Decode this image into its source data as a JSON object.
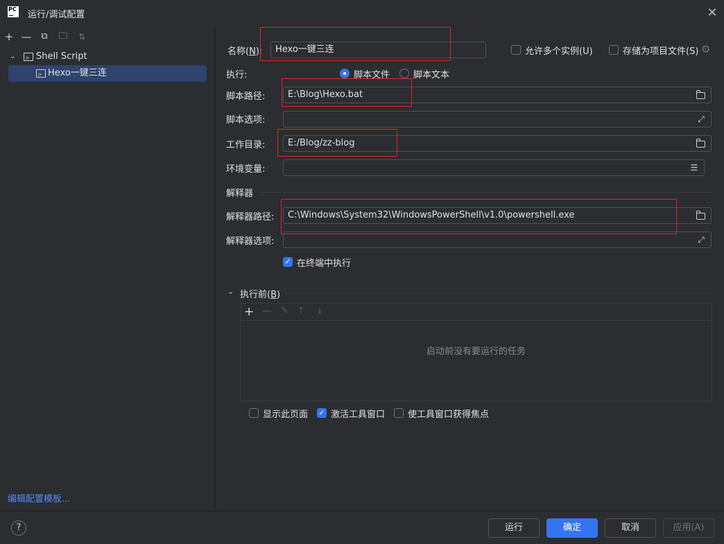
{
  "window": {
    "title": "运行/调试配置",
    "logo_text": "PC"
  },
  "sidebar": {
    "tree_group": "Shell Script",
    "tree_item": "Hexo一键三连",
    "edit_templates_link": "编辑配置模板..."
  },
  "form": {
    "name_label": "名称(",
    "name_mnemonic": "N",
    "name_label_end": "):",
    "name_value": "Hexo一键三连",
    "allow_multiple_label": "允许多个实例(U)",
    "store_as_file_label": "存储为项目文件(S)",
    "execute_label": "执行:",
    "radio_script_file": "脚本文件",
    "radio_script_text": "脚本文本",
    "script_path_label": "脚本路径:",
    "script_path_value": "E:\\Blog\\Hexo.bat",
    "script_options_label": "脚本选项:",
    "script_options_value": "",
    "workdir_label": "工作目录:",
    "workdir_value": "E:/Blog/zz-blog",
    "env_label": "环境变量:",
    "env_value": "",
    "interpreter_section": "解释器",
    "interpreter_path_label": "解释器路径:",
    "interpreter_path_value": "C:\\Windows\\System32\\WindowsPowerShell\\v1.0\\powershell.exe",
    "interpreter_options_label": "解释器选项:",
    "interpreter_options_value": "",
    "run_in_terminal_label": "在终端中执行"
  },
  "before_launch": {
    "header_prefix": "执行前(",
    "header_mnemonic": "B",
    "header_suffix": ")",
    "empty_text": "启动前没有要运行的任务",
    "show_page_label": "显示此页面",
    "activate_tool_window_label": "激活工具窗口",
    "focus_tool_window_label": "使工具窗口获得焦点"
  },
  "buttons": {
    "help": "?",
    "run": "运行",
    "ok": "确定",
    "cancel": "取消",
    "apply": "应用(A)"
  },
  "state": {
    "allow_multiple": false,
    "store_as_file": false,
    "execute_mode": "脚本文件",
    "run_in_terminal": true,
    "show_page": false,
    "activate_tool_window": true,
    "focus_tool_window": false
  },
  "colors": {
    "background": "#2b2d30",
    "accent": "#3574f0",
    "selection": "#2e436e",
    "highlight_box": "#e0262e",
    "link": "#548af7"
  }
}
